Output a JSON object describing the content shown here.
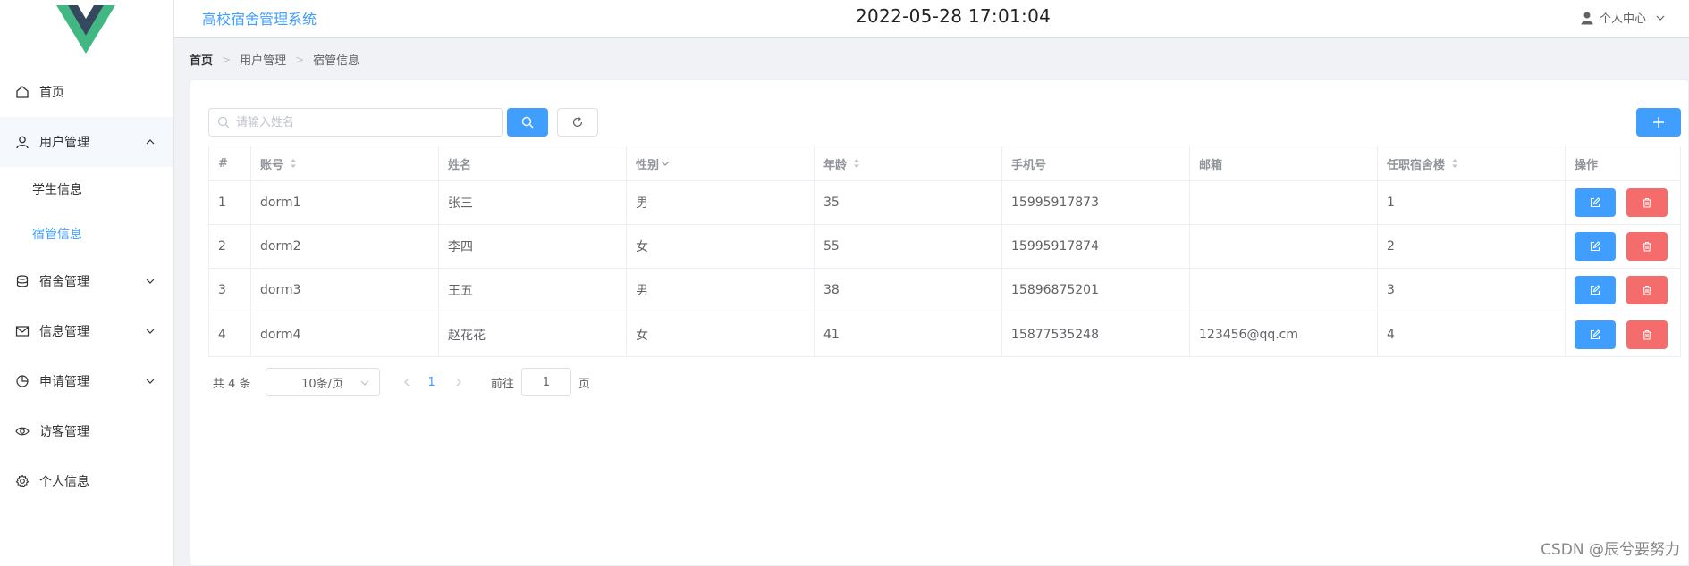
{
  "header": {
    "app_title": "高校宿舍管理系统",
    "clock": "2022-05-28 17:01:04",
    "user_menu_label": "个人中心"
  },
  "sidebar": {
    "items": [
      {
        "label": "首页",
        "icon": "home-icon"
      },
      {
        "label": "用户管理",
        "icon": "user-icon",
        "expanded": true,
        "children": [
          {
            "label": "学生信息"
          },
          {
            "label": "宿管信息",
            "selected": true
          }
        ]
      },
      {
        "label": "宿舍管理",
        "icon": "database-icon"
      },
      {
        "label": "信息管理",
        "icon": "message-icon"
      },
      {
        "label": "申请管理",
        "icon": "pie-chart-icon"
      },
      {
        "label": "访客管理",
        "icon": "eye-icon"
      },
      {
        "label": "个人信息",
        "icon": "gear-icon"
      }
    ]
  },
  "breadcrumb": [
    "首页",
    "用户管理",
    "宿管信息"
  ],
  "search": {
    "placeholder": "请输入姓名",
    "value": ""
  },
  "table": {
    "columns": [
      {
        "label": "#"
      },
      {
        "label": "账号",
        "sortable": true
      },
      {
        "label": "姓名"
      },
      {
        "label": "性别",
        "filter": true
      },
      {
        "label": "年龄",
        "sortable": true
      },
      {
        "label": "手机号"
      },
      {
        "label": "邮箱"
      },
      {
        "label": "任职宿舍楼",
        "sortable": true
      },
      {
        "label": "操作"
      }
    ],
    "rows": [
      {
        "index": "1",
        "account": "dorm1",
        "name": "张三",
        "gender": "男",
        "age": "35",
        "phone": "15995917873",
        "email": "",
        "building": "1"
      },
      {
        "index": "2",
        "account": "dorm2",
        "name": "李四",
        "gender": "女",
        "age": "55",
        "phone": "15995917874",
        "email": "",
        "building": "2"
      },
      {
        "index": "3",
        "account": "dorm3",
        "name": "王五",
        "gender": "男",
        "age": "38",
        "phone": "15896875201",
        "email": "",
        "building": "3"
      },
      {
        "index": "4",
        "account": "dorm4",
        "name": "赵花花",
        "gender": "女",
        "age": "41",
        "phone": "15877535248",
        "email": "123456@qq.cm",
        "building": "4"
      }
    ]
  },
  "pagination": {
    "total": "共 4 条",
    "page_size": "10条/页",
    "current_page": "1",
    "goto_label": "前往",
    "goto_value": "1",
    "page_suffix": "页"
  },
  "watermark": "CSDN @辰兮要努力",
  "colors": {
    "primary": "#409eff",
    "danger": "#f56c6c",
    "logo_green": "#41b883",
    "logo_dark": "#35495e"
  }
}
